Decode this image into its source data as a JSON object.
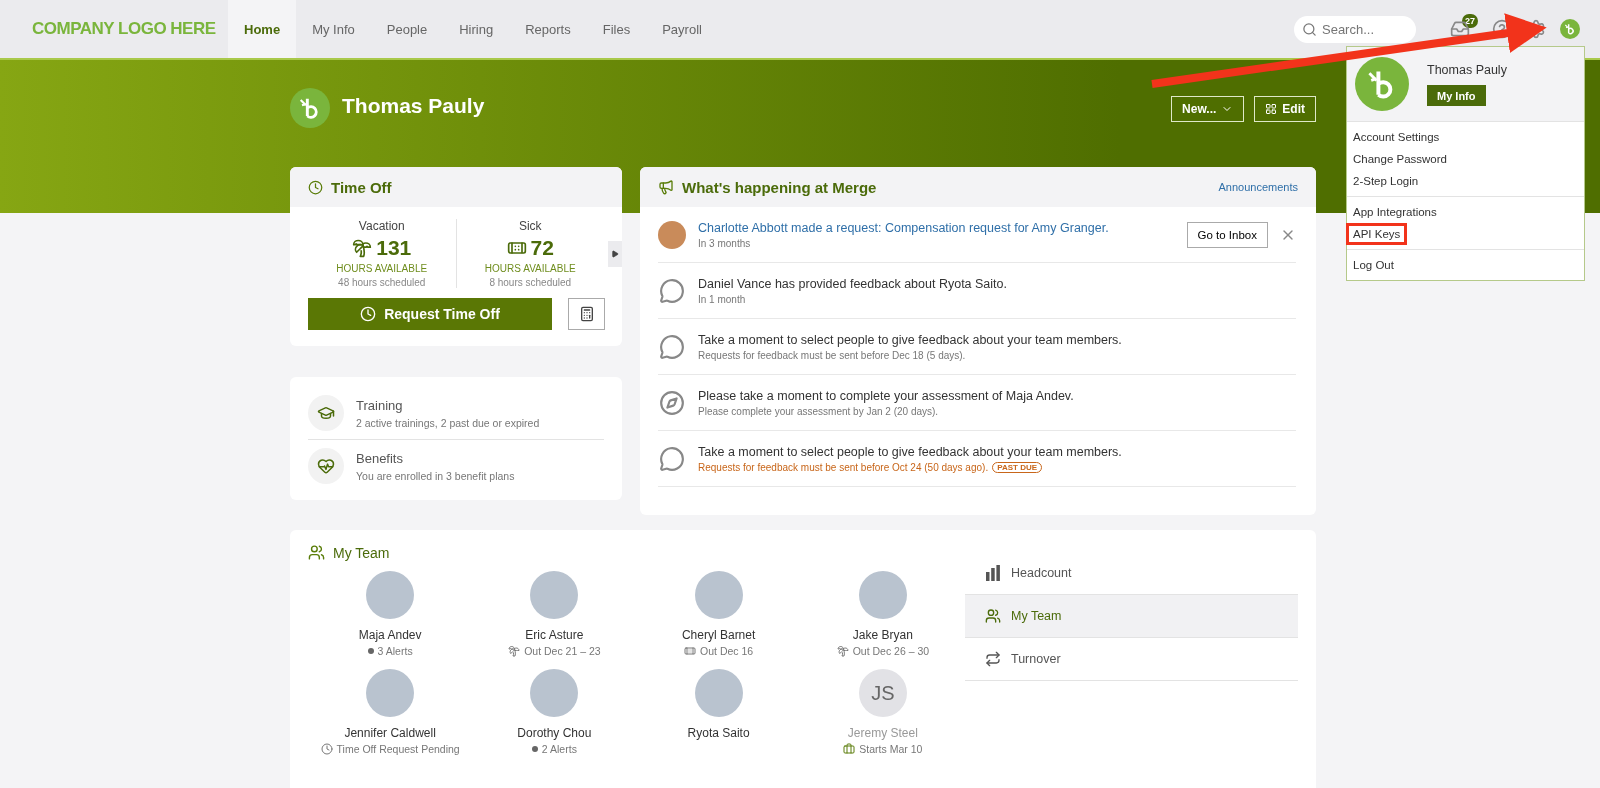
{
  "logo": {
    "text": "COMPANY LOGO HERE"
  },
  "nav": {
    "tabs": [
      {
        "label": "Home",
        "selected": true
      },
      {
        "label": "My Info",
        "selected": false
      },
      {
        "label": "People",
        "selected": false
      },
      {
        "label": "Hiring",
        "selected": false
      },
      {
        "label": "Reports",
        "selected": false
      },
      {
        "label": "Files",
        "selected": false
      },
      {
        "label": "Payroll",
        "selected": false
      }
    ],
    "search": {
      "placeholder": "Search..."
    },
    "inbox_count": "27"
  },
  "profile": {
    "name": "Thomas Pauly",
    "buttons": [
      {
        "kind": "menu",
        "label": "New..."
      },
      {
        "kind": "grid",
        "label": "Edit"
      }
    ]
  },
  "user_menu": {
    "name": "Thomas Pauly",
    "button": "My Info",
    "groups": [
      [
        {
          "label": "Account Settings",
          "highlighted": false
        },
        {
          "label": "Change Password",
          "highlighted": false
        },
        {
          "label": "2-Step Login",
          "highlighted": false
        }
      ],
      [
        {
          "label": "App Integrations",
          "highlighted": false
        },
        {
          "label": "API Keys",
          "highlighted": true
        }
      ],
      [
        {
          "label": "Log Out",
          "highlighted": false
        }
      ]
    ]
  },
  "time_off": {
    "title": "Time Off",
    "balances": [
      {
        "kind": "vacation",
        "label": "Vacation",
        "hours": "131",
        "caption": "HOURS AVAILABLE",
        "scheduled": "48 hours scheduled"
      },
      {
        "kind": "sick",
        "label": "Sick",
        "hours": "72",
        "caption": "HOURS AVAILABLE",
        "scheduled": "8 hours scheduled"
      }
    ],
    "request_button": "Request Time Off"
  },
  "summary": [
    {
      "kind": "training",
      "title": "Training",
      "detail": "2 active trainings, 2 past due or expired"
    },
    {
      "kind": "benefits",
      "title": "Benefits",
      "detail": "You are enrolled in 3 benefit plans"
    }
  ],
  "feed": {
    "title": "What's happening at Merge",
    "link": "Announcements",
    "items": [
      {
        "kind": "photo",
        "title": "Charlotte Abbott made a request: Compensation request for Amy Granger.",
        "link": true,
        "detail": "In 3 months",
        "overdue": false,
        "action": "Go to Inbox",
        "dismissable": true
      },
      {
        "kind": "feedback",
        "title": "Daniel Vance has provided feedback about Ryota Saito.",
        "link": false,
        "detail": "In 1 month",
        "overdue": false,
        "dismissable": false
      },
      {
        "kind": "feedback",
        "title": "Take a moment to select people to give feedback about your team members.",
        "link": false,
        "detail": "Requests for feedback must be sent before Dec 18 (5 days).",
        "overdue": false,
        "dismissable": false
      },
      {
        "kind": "assessment",
        "title": "Please take a moment to complete your assessment of Maja Andev.",
        "link": false,
        "detail": "Please complete your assessment by Jan 2 (20 days).",
        "overdue": false,
        "dismissable": false
      },
      {
        "kind": "feedback",
        "title": "Take a moment to select people to give feedback about your team members.",
        "link": false,
        "detail": "Requests for feedback must be sent before Oct 24 (50 days ago).",
        "overdue": true,
        "badge": "PAST DUE",
        "dismissable": false
      }
    ]
  },
  "team": {
    "title": "My Team",
    "members": [
      {
        "name": "Maja Andev",
        "status": "3 Alerts",
        "kind": "alerts",
        "inactive": false
      },
      {
        "name": "Eric Asture",
        "status": "Out Dec 21 – 23",
        "kind": "vacation",
        "inactive": false
      },
      {
        "name": "Cheryl Barnet",
        "status": "Out Dec 16",
        "kind": "sick",
        "inactive": false
      },
      {
        "name": "Jake Bryan",
        "status": "Out Dec 26 – 30",
        "kind": "vacation",
        "inactive": false
      },
      {
        "name": "Jennifer Caldwell",
        "status": "Time Off Request Pending",
        "kind": "pending",
        "inactive": false
      },
      {
        "name": "Dorothy Chou",
        "status": "2 Alerts",
        "kind": "alerts",
        "inactive": false
      },
      {
        "name": "Ryota Saito",
        "inactive": false
      },
      {
        "name": "Jeremy Steel",
        "status": "Starts Mar 10",
        "kind": "starts",
        "initials": "JS",
        "inactive": true
      }
    ],
    "views": [
      {
        "kind": "headcount",
        "label": "Headcount",
        "selected": false
      },
      {
        "kind": "team",
        "label": "My Team",
        "selected": true
      },
      {
        "kind": "turnover",
        "label": "Turnover",
        "selected": false
      }
    ]
  }
}
